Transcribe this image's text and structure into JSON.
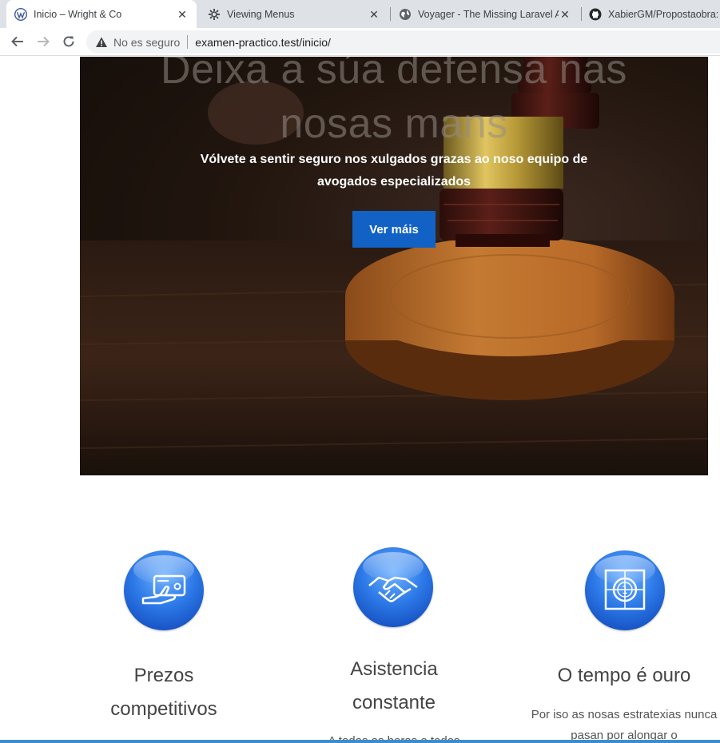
{
  "browser": {
    "tabs": [
      {
        "title": "Inicio – Wright & Co",
        "icon": "wordpress-icon",
        "active": true
      },
      {
        "title": "Viewing Menus",
        "icon": "gear-icon",
        "active": false
      },
      {
        "title": "Voyager - The Missing Laravel Ad",
        "icon": "globe-icon",
        "active": false
      },
      {
        "title": "XabierGM/Propostaobra: C",
        "icon": "github-icon",
        "active": false
      }
    ],
    "security_label": "No es seguro",
    "url": "examen-practico.test/inicio/"
  },
  "hero": {
    "heading_line1": "Deixa a súa defensa nas",
    "heading_line2": "nosas mans",
    "subtitle": "Vólvete a sentir seguro nos xulgados grazas ao noso equipo de avogados especializados",
    "cta_label": "Ver máis"
  },
  "features": [
    {
      "icon": "payment-card-hand-icon",
      "title_line1": "Prezos",
      "title_line2": "competitivos",
      "description": ""
    },
    {
      "icon": "handshake-icon",
      "title_line1": "Asistencia",
      "title_line2": "constante",
      "description": "A todas as horas e todos"
    },
    {
      "icon": "countdown-clock-icon",
      "title_line1": "O tempo é ouro",
      "title_line2": "",
      "description": "Por iso as nosas estratexias nunca pasan por alongar o"
    }
  ],
  "colors": {
    "accent": "#1162c4",
    "feature_icon": "#1f6ee0"
  }
}
